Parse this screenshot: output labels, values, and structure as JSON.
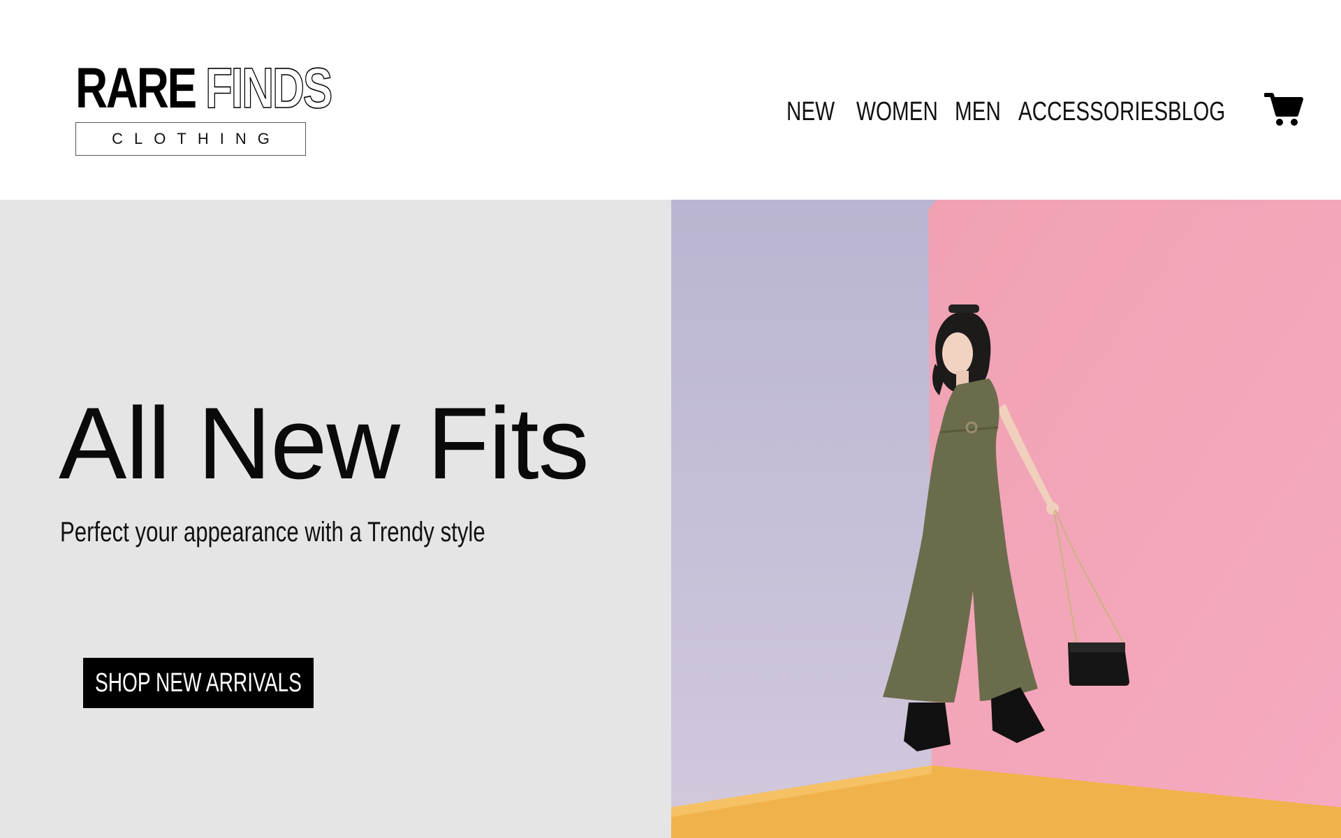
{
  "brand": {
    "name_bold": "RARE",
    "name_outline": "FINDS",
    "subtitle": "CLOTHING"
  },
  "nav": {
    "items": [
      {
        "label": "NEW"
      },
      {
        "label": "WOMEN"
      },
      {
        "label": "MEN"
      },
      {
        "label": "ACCESSORIES"
      },
      {
        "label": "BLOG"
      }
    ],
    "cart_icon": "shopping-cart-icon"
  },
  "hero": {
    "title": "All New Fits",
    "subtitle": "Perfect your appearance with a Trendy style",
    "cta_label": "SHOP NEW ARRIVALS",
    "image_alt": "Model in olive green jumpsuit with black handbag against lavender and pink backdrop"
  },
  "colors": {
    "hero_left_bg": "#e5e5e6",
    "button_bg": "#000000",
    "backdrop_lavender": "#c2bed6",
    "backdrop_pink": "#f3a6b8",
    "floor_yellow": "#f0b24a",
    "jumpsuit_olive": "#6b6c4c"
  }
}
